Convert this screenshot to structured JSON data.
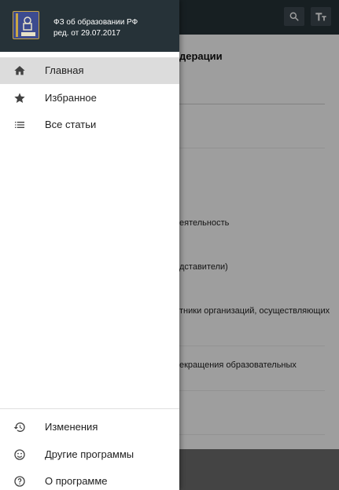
{
  "background": {
    "heading_fragment": "дерации",
    "items": [
      "еятельность",
      "дставители)",
      "тники организаций, осуществляющих",
      "екращения образовательных"
    ]
  },
  "drawer": {
    "header": {
      "title": "ФЗ об образовании РФ",
      "subtitle": "ред. от 29.07.2017"
    },
    "nav_items": [
      {
        "label": "Главная",
        "icon": "home-icon",
        "active": true
      },
      {
        "label": "Избранное",
        "icon": "star-icon",
        "active": false
      },
      {
        "label": "Все статьи",
        "icon": "list-icon",
        "active": false
      }
    ],
    "footer_items": [
      {
        "label": "Изменения",
        "icon": "history-icon"
      },
      {
        "label": "Другие программы",
        "icon": "smiley-icon"
      },
      {
        "label": "О программе",
        "icon": "help-icon"
      }
    ]
  },
  "colors": {
    "header": "#263238",
    "active_item": "#dcdcdc",
    "icon": "#424242"
  }
}
